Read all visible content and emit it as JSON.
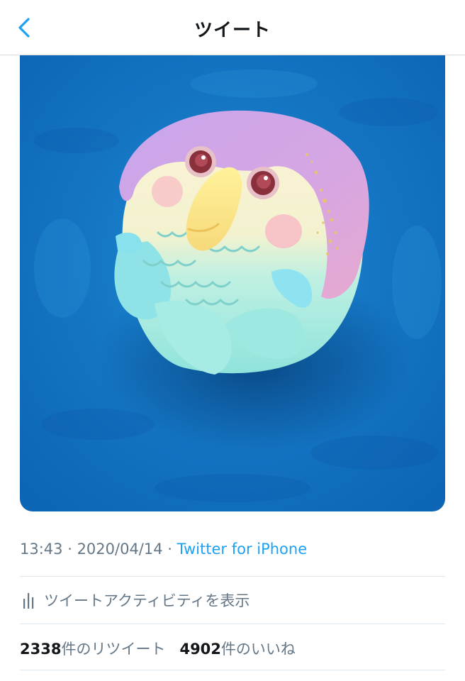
{
  "header": {
    "title": "ツイート",
    "back_icon": "chevron-left-icon"
  },
  "tweet": {
    "image_description": "owl-shaped wagashi sweet on blue background",
    "time": "13:43",
    "date": "2020/04/14",
    "separator": " · ",
    "source": "Twitter for iPhone",
    "activity_icon": "bar-chart-icon",
    "activity_label": "ツイートアクティビティを表示",
    "retweets_count": "2338",
    "retweets_label": "件のリツイート",
    "likes_count": "4902",
    "likes_label": "件のいいね"
  },
  "colors": {
    "accent": "#1da1f2",
    "secondary_text": "#657786",
    "primary_text": "#14171a",
    "divider": "#e1e8ed"
  }
}
